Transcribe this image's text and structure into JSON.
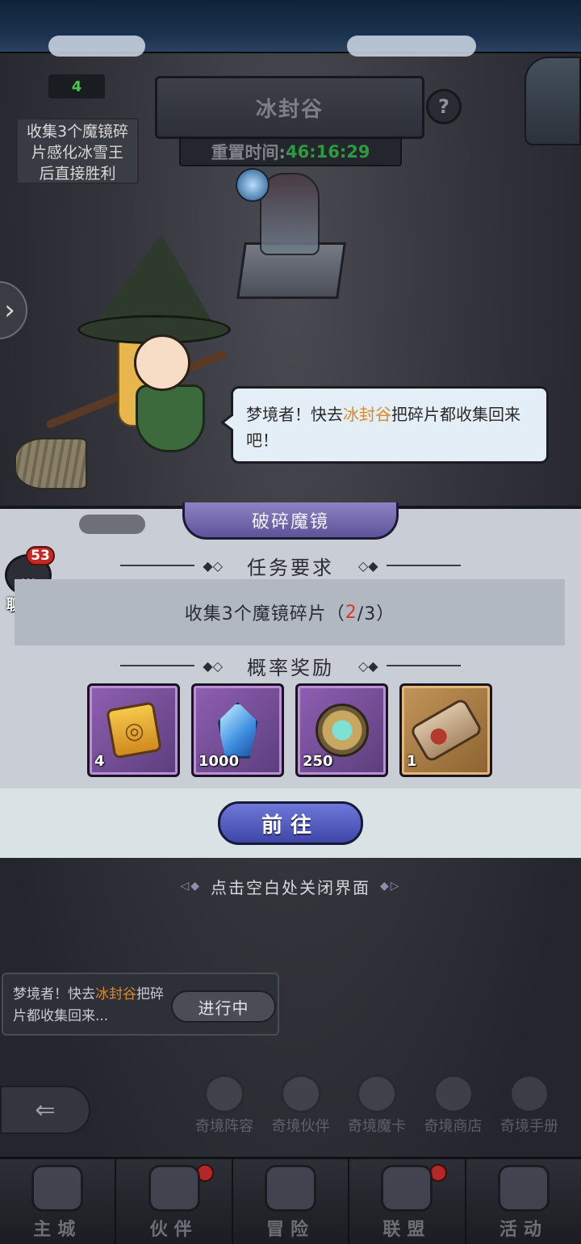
{
  "header": {
    "level": "4",
    "goal_text": "收集3个魔镜碎片感化冰雪王后直接胜利",
    "map_title": "冰封谷",
    "reset_label": "重置时间:",
    "reset_time": "46:16:29",
    "help_icon": "?"
  },
  "dialog": {
    "part1": "梦境者！快去",
    "highlight": "冰封谷",
    "part2": "把碎片都收集回来吧！"
  },
  "panel": {
    "tab_title": "破碎魔镜",
    "requirement_heading": "任务要求",
    "requirement_text": "收集3个魔镜碎片（",
    "progress_current": "2",
    "progress_total": "/3）",
    "reward_heading": "概率奖励",
    "rewards": [
      {
        "icon": "rune-token-icon",
        "quantity": "4",
        "rarity": "purple"
      },
      {
        "icon": "blue-crystal-icon",
        "quantity": "1000",
        "rarity": "purple"
      },
      {
        "icon": "spiked-medallion-icon",
        "quantity": "250",
        "rarity": "purple"
      },
      {
        "icon": "scroll-icon",
        "quantity": "1",
        "rarity": "gold"
      }
    ],
    "goto_label": "前往",
    "close_hint": "点击空白处关闭界面"
  },
  "chat": {
    "count": "53",
    "label": "聊天",
    "icon": "..."
  },
  "tracker": {
    "part1": "梦境者！快去",
    "highlight": "冰封谷",
    "part2": "把碎片都收集回来...",
    "status": "进行中"
  },
  "features": [
    {
      "label": "奇境阵容",
      "icon": "chess-icon"
    },
    {
      "label": "奇境伙伴",
      "icon": "partner-icon"
    },
    {
      "label": "奇境魔卡",
      "icon": "card-icon"
    },
    {
      "label": "奇境商店",
      "icon": "shop-icon"
    },
    {
      "label": "奇境手册",
      "icon": "handbook-icon"
    }
  ],
  "nav": [
    {
      "label": "主城",
      "icon": "castle-icon",
      "dot": false
    },
    {
      "label": "伙伴",
      "icon": "witch-hat-icon",
      "dot": true
    },
    {
      "label": "冒险",
      "icon": "compass-icon",
      "dot": false
    },
    {
      "label": "联盟",
      "icon": "shield-icon",
      "dot": true
    },
    {
      "label": "活动",
      "icon": "cards-icon",
      "dot": false
    }
  ],
  "colors": {
    "accent_purple": "#6f78d8",
    "highlight_orange": "#d98a2a",
    "progress_red": "#d63a2d",
    "timer_green": "#2f9a3d",
    "notification_red": "#c32a26"
  }
}
